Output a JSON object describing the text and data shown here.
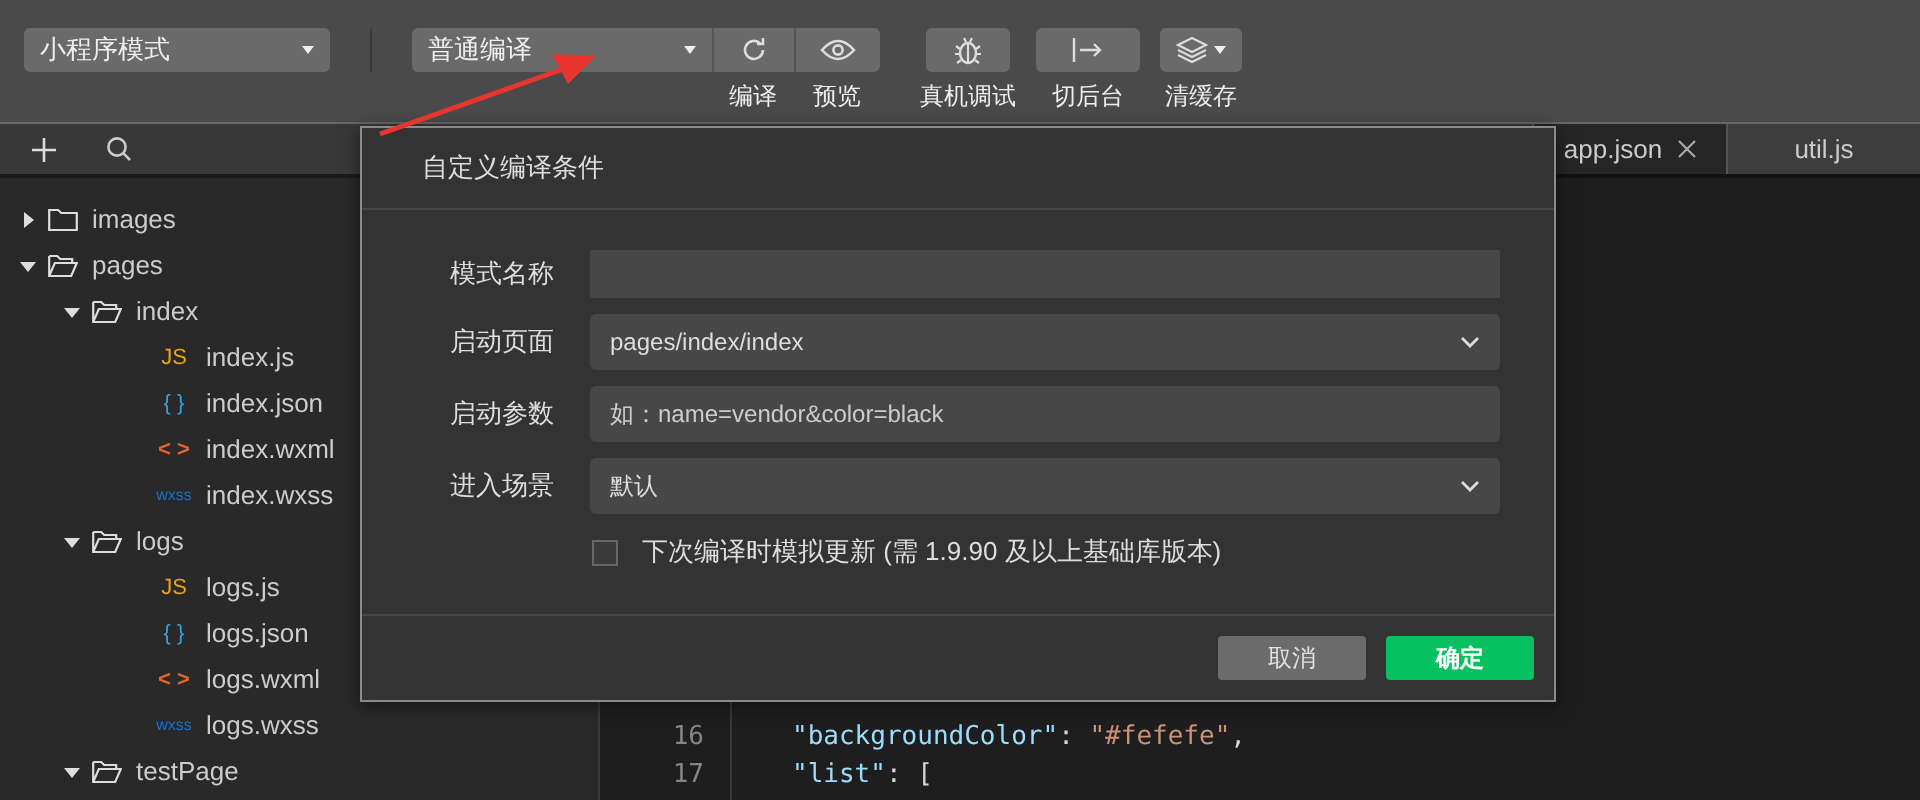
{
  "toolbar": {
    "mode_select": {
      "value": "小程序模式"
    },
    "compile_select": {
      "value": "普通编译"
    },
    "actions": [
      {
        "kind": "refresh",
        "label": "编译"
      },
      {
        "kind": "preview",
        "label": "预览"
      },
      {
        "kind": "debug",
        "label": "真机调试"
      },
      {
        "kind": "background",
        "label": "切后台"
      },
      {
        "kind": "cache",
        "label": "清缓存"
      }
    ]
  },
  "sidebar": {
    "tree": [
      {
        "name": "images",
        "kind": "folder",
        "expanded": false
      },
      {
        "name": "pages",
        "kind": "folder",
        "expanded": true,
        "children": [
          {
            "name": "index",
            "kind": "folder",
            "expanded": true,
            "children": [
              {
                "name": "index.js",
                "kind": "js",
                "badge": "JS"
              },
              {
                "name": "index.json",
                "kind": "json",
                "badge": "{ }"
              },
              {
                "name": "index.wxml",
                "kind": "wxml",
                "badge": "< >"
              },
              {
                "name": "index.wxss",
                "kind": "wxss",
                "badge": "wxss"
              }
            ]
          },
          {
            "name": "logs",
            "kind": "folder",
            "expanded": true,
            "children": [
              {
                "name": "logs.js",
                "kind": "js",
                "badge": "JS"
              },
              {
                "name": "logs.json",
                "kind": "json",
                "badge": "{ }"
              },
              {
                "name": "logs.wxml",
                "kind": "wxml",
                "badge": "< >"
              },
              {
                "name": "logs.wxss",
                "kind": "wxss",
                "badge": "wxss"
              }
            ]
          },
          {
            "name": "testPage",
            "kind": "folder",
            "expanded": true
          }
        ]
      }
    ]
  },
  "editor": {
    "tabs": [
      {
        "label": "app.json",
        "selected": true
      },
      {
        "label": "util.js",
        "selected": false
      }
    ],
    "lines": [
      {
        "number": "16",
        "parts": [
          {
            "kind": "key",
            "text": "\"backgroundColor\""
          },
          {
            "kind": "punct",
            "text": ": "
          },
          {
            "kind": "string",
            "text": "\"#fefefe\""
          },
          {
            "kind": "punct",
            "text": ","
          }
        ]
      },
      {
        "number": "17",
        "parts": [
          {
            "kind": "key",
            "text": "\"list\""
          },
          {
            "kind": "punct",
            "text": ": ["
          }
        ]
      }
    ]
  },
  "dialog": {
    "title": "自定义编译条件",
    "fields": [
      {
        "label": "模式名称",
        "kind": "text"
      },
      {
        "label": "启动页面",
        "kind": "select",
        "value": "pages/index/index"
      },
      {
        "label": "启动参数",
        "kind": "text",
        "placeholder": "如：name=vendor&color=black"
      },
      {
        "label": "进入场景",
        "kind": "select",
        "value": "默认"
      }
    ],
    "checkbox": {
      "label": "下次编译时模拟更新 (需 1.9.90 及以上基础库版本)",
      "checked": false
    },
    "buttons": [
      {
        "label": "取消",
        "kind": "secondary"
      },
      {
        "label": "确定",
        "kind": "primary"
      }
    ]
  }
}
